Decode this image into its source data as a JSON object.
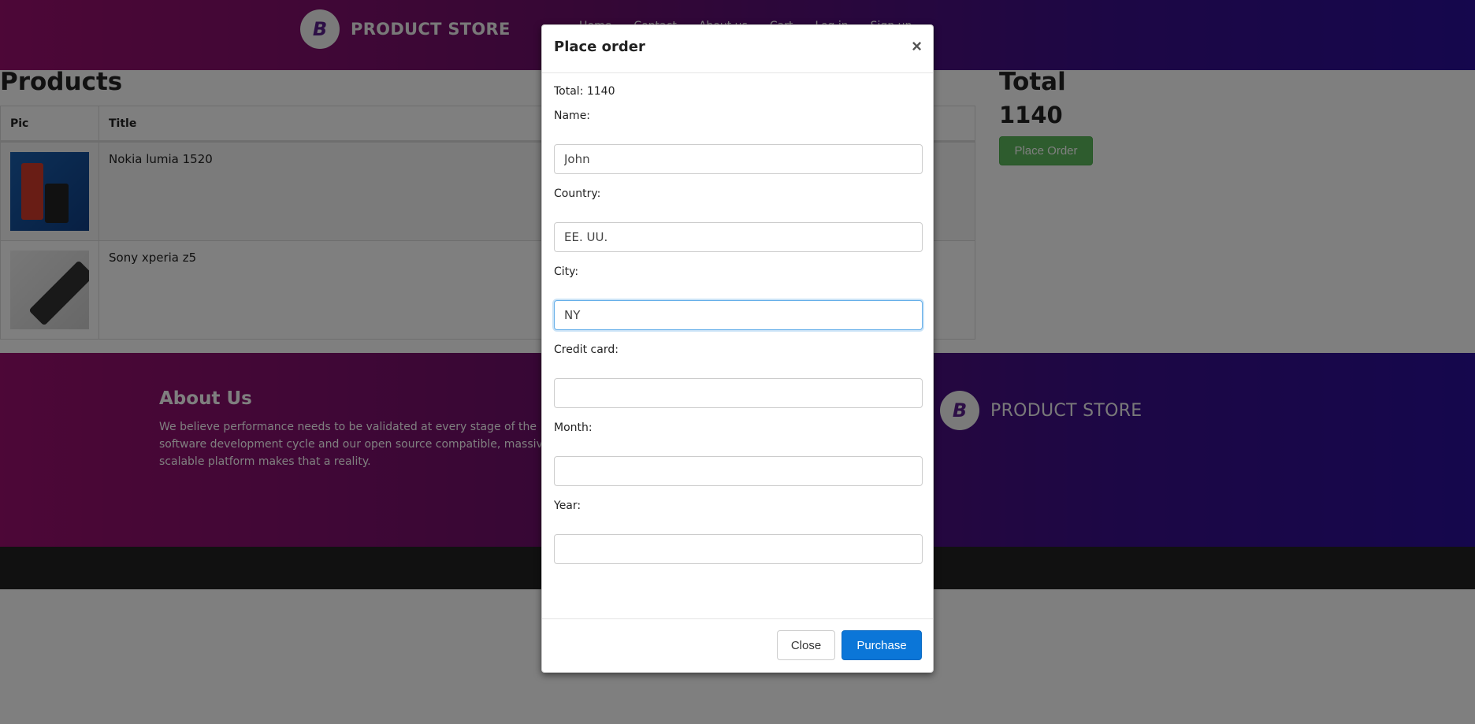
{
  "navbar": {
    "brand": "PRODUCT STORE",
    "logo_letter": "B",
    "links": [
      "Home",
      "Contact",
      "About us",
      "Cart",
      "Log in",
      "Sign up"
    ]
  },
  "products": {
    "title": "Products",
    "columns": [
      "Pic",
      "Title"
    ],
    "rows": [
      {
        "title": "Nokia lumia 1520"
      },
      {
        "title": "Sony xperia z5"
      }
    ]
  },
  "summary": {
    "total_label": "Total",
    "total_value": "1140",
    "place_order_label": "Place Order"
  },
  "footer": {
    "about_title": "About Us",
    "about_text": "We believe performance needs to be validated at every stage of the software development cycle and our open source compatible, massively scalable platform makes that a reality.",
    "brand": "PRODUCT STORE"
  },
  "modal": {
    "title": "Place order",
    "close_symbol": "×",
    "total_line": "Total: 1140",
    "fields": {
      "name": {
        "label": "Name:",
        "value": "John"
      },
      "country": {
        "label": "Country:",
        "value": "EE. UU."
      },
      "city": {
        "label": "City:",
        "value": "NY"
      },
      "card": {
        "label": "Credit card:",
        "value": ""
      },
      "month": {
        "label": "Month:",
        "value": ""
      },
      "year": {
        "label": "Year:",
        "value": ""
      }
    },
    "close_button": "Close",
    "purchase_button": "Purchase"
  },
  "colors": {
    "purchase": "#0b76d8",
    "place_order": "#5cb85c",
    "header_gradient_start": "#9a0f6e",
    "header_gradient_end": "#2a0f9a"
  }
}
